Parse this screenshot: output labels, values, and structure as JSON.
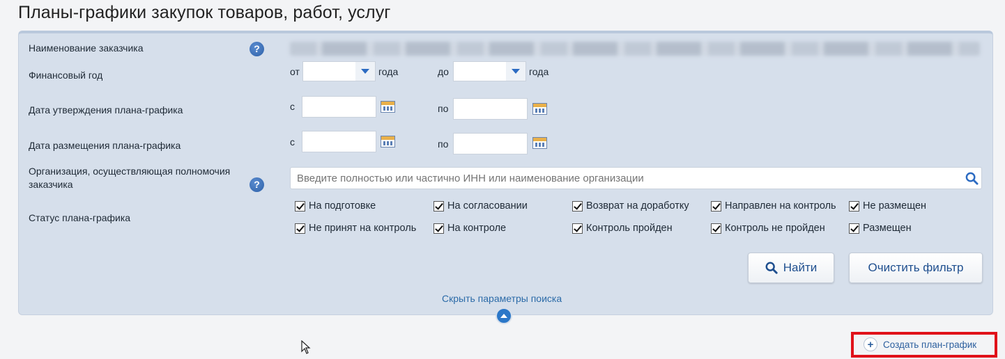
{
  "page": {
    "title": "Планы-графики закупок товаров, работ, услуг"
  },
  "filters": {
    "customer": {
      "label": "Наименование заказчика"
    },
    "fin_year": {
      "label": "Финансовый год",
      "from": "от",
      "to": "до",
      "suffix": "года"
    },
    "approval_date": {
      "label": "Дата утверждения плана-графика",
      "from": "с",
      "to": "по"
    },
    "placement_date": {
      "label": "Дата размещения плана-графика",
      "from": "с",
      "to": "по"
    },
    "org": {
      "label_line1": "Организация, осуществляющая полномочия",
      "label_line2": "заказчика",
      "placeholder": "Введите полностью или частично ИНН или наименование организации"
    },
    "status": {
      "label": "Статус плана-графика",
      "options": [
        "На подготовке",
        "На согласовании",
        "Возврат на доработку",
        "Направлен на контроль",
        "Не размещен",
        "Не принят на контроль",
        "На контроле",
        "Контроль пройден",
        "Контроль не пройден",
        "Размещен"
      ],
      "checked": [
        true,
        true,
        true,
        true,
        true,
        true,
        true,
        true,
        true,
        true
      ]
    }
  },
  "buttons": {
    "find": "Найти",
    "clear": "Очистить фильтр",
    "hide_params": "Скрыть параметры поиска",
    "create": "Создать план-график"
  },
  "colors": {
    "highlight": "#e0121a",
    "accent": "#2b77c8"
  }
}
